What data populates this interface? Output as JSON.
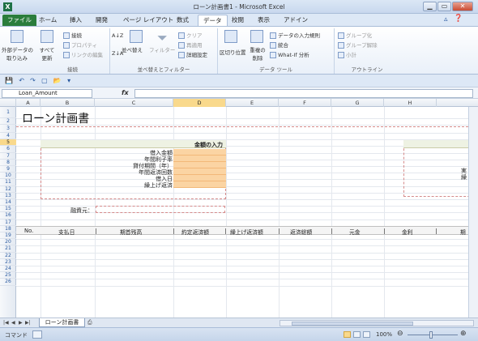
{
  "window": {
    "title": "ローン計画書1 - Microsoft Excel",
    "minimize": "▁",
    "restore": "▭",
    "close": "✕"
  },
  "tabs": [
    "ファイル",
    "ホーム",
    "挿入",
    "開発",
    "ページ レイアウト",
    "数式",
    "データ",
    "校閲",
    "表示",
    "アドイン"
  ],
  "ribbon": {
    "external": "外部データの\n取り込み",
    "refresh_all": "すべて\n更新",
    "connections": "接続",
    "properties": "プロパティ",
    "edit_links": "リンクの編集",
    "group_connections": "接続",
    "sort_az": "A↓Z",
    "sort_za": "Z↓A",
    "sort": "並べ替え",
    "filter": "フィルター",
    "clear": "クリア",
    "reapply": "再適用",
    "advanced": "詳細設定",
    "group_sort_filter": "並べ替えとフィルター",
    "text_to_columns": "区切り位置",
    "remove_dup": "重複の\n削除",
    "data_validation": "データの入力規則",
    "consolidate": "統合",
    "what_if": "What-If 分析",
    "group_data_tools": "データ ツール",
    "group": "グループ化",
    "ungroup": "グループ解除",
    "subtotal": "小計",
    "group_outline": "アウトライン"
  },
  "formula_bar": {
    "name_box": "Loan_Amount",
    "fx": "fx",
    "value": ""
  },
  "columns": [
    "A",
    "B",
    "C",
    "D",
    "E",
    "F",
    "G",
    "H"
  ],
  "selected_column": "D",
  "rows": [
    "1",
    "2",
    "3",
    "4",
    "5",
    "6",
    "7",
    "8",
    "9",
    "10",
    "11",
    "12",
    "13",
    "14",
    "15",
    "16",
    "17",
    "18",
    "19",
    "20",
    "21",
    "22",
    "23",
    "24",
    "25",
    "26"
  ],
  "selected_row": "5",
  "sheet": {
    "title": "ローン計画書",
    "input_header": "金額の入力",
    "inputs": [
      "借入金額",
      "年間利子率",
      "貸付期間（年）",
      "年間返済回数",
      "借入日",
      "繰上げ返済"
    ],
    "right_partial": [
      "実",
      "繰"
    ],
    "lender_label": "融資元：",
    "table_headers": [
      "No.",
      "支払日",
      "期首残高",
      "約定返済額",
      "繰上げ返済額",
      "返済総額",
      "元金",
      "金利",
      "期"
    ]
  },
  "sheet_tabs": {
    "active": "ローン計画書"
  },
  "status": {
    "mode": "コマンド",
    "zoom": "100%"
  }
}
